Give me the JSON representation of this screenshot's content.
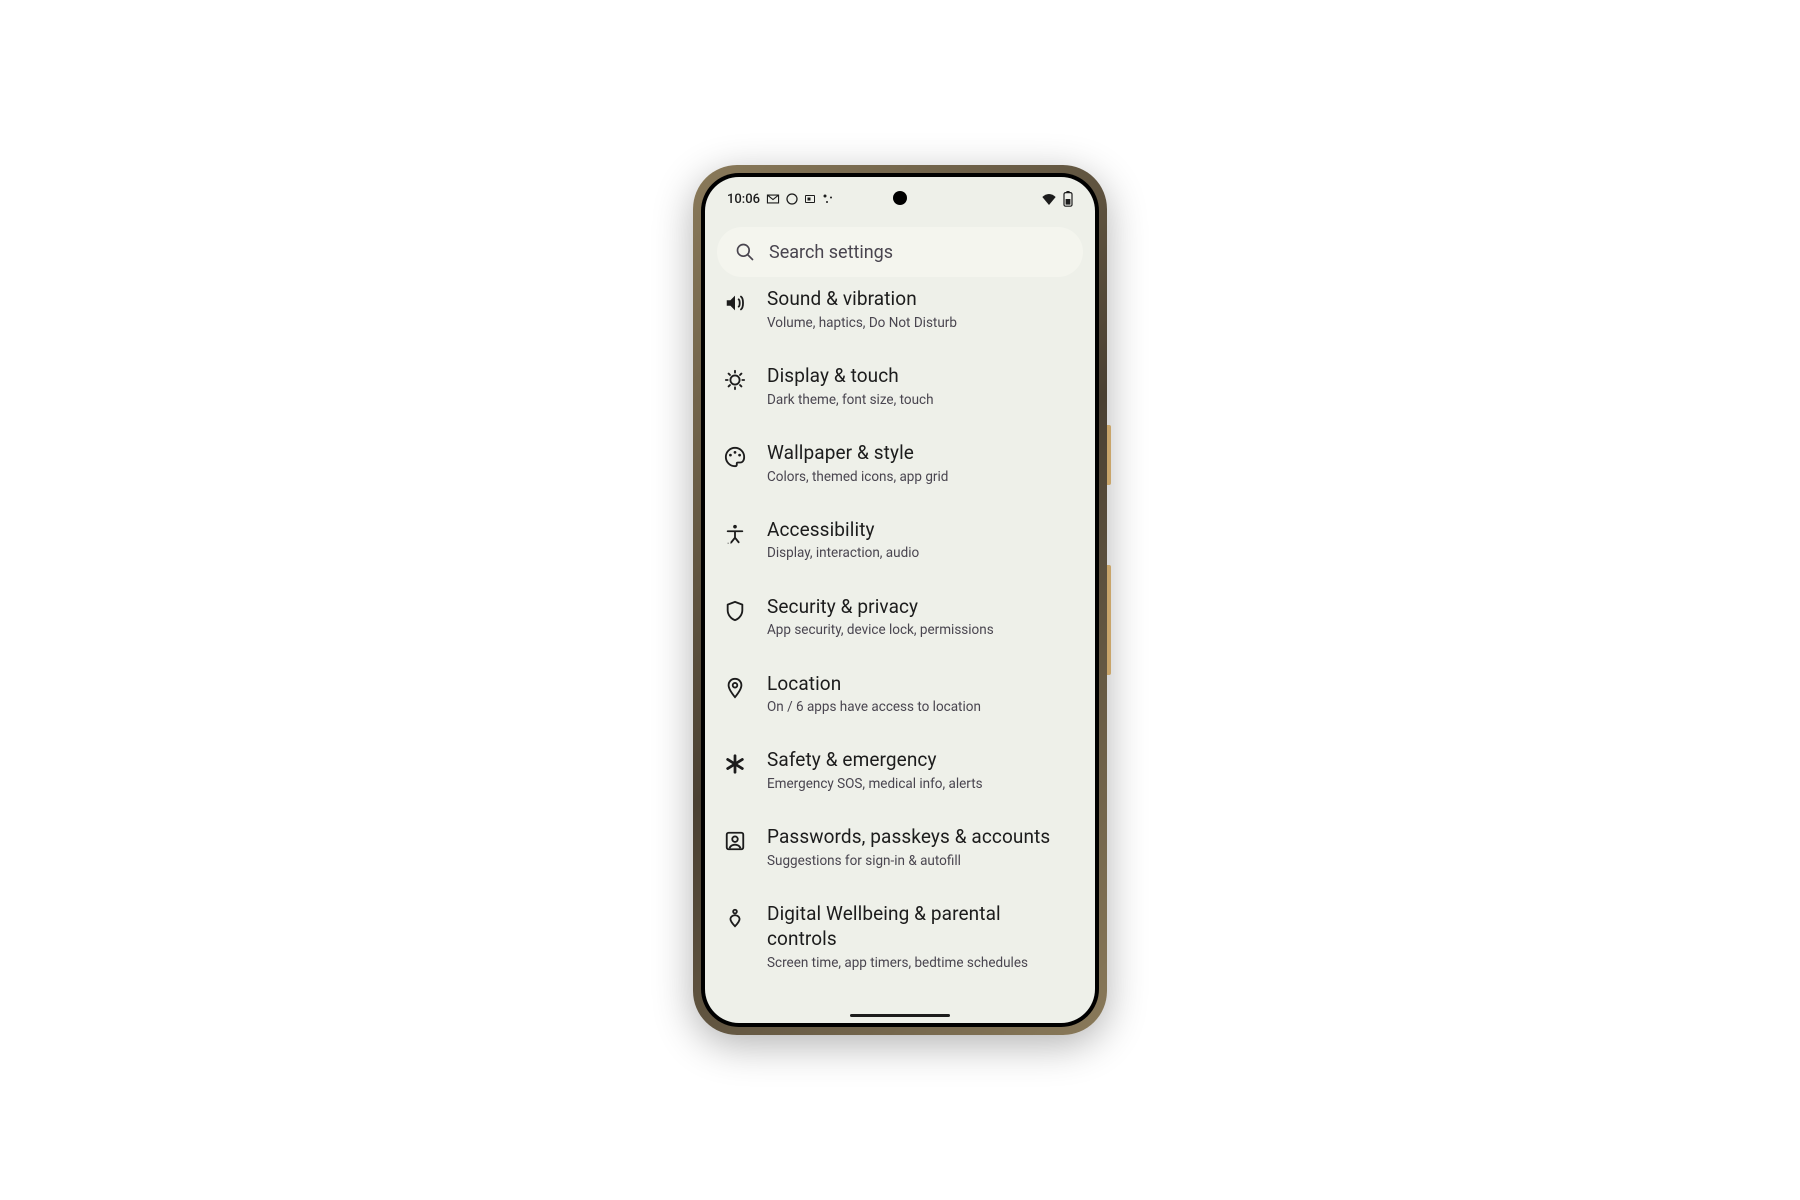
{
  "status": {
    "time": "10:06"
  },
  "search": {
    "placeholder": "Search settings"
  },
  "items": [
    {
      "title": "Sound & vibration",
      "sub": "Volume, haptics, Do Not Disturb"
    },
    {
      "title": "Display & touch",
      "sub": "Dark theme, font size, touch"
    },
    {
      "title": "Wallpaper & style",
      "sub": "Colors, themed icons, app grid"
    },
    {
      "title": "Accessibility",
      "sub": "Display, interaction, audio"
    },
    {
      "title": "Security & privacy",
      "sub": "App security, device lock, permissions"
    },
    {
      "title": "Location",
      "sub": "On / 6 apps have access to location"
    },
    {
      "title": "Safety & emergency",
      "sub": "Emergency SOS, medical info, alerts"
    },
    {
      "title": "Passwords, passkeys & accounts",
      "sub": "Suggestions for sign-in & autofill"
    },
    {
      "title": "Digital Wellbeing & parental controls",
      "sub": "Screen time, app timers, bedtime schedules"
    }
  ]
}
